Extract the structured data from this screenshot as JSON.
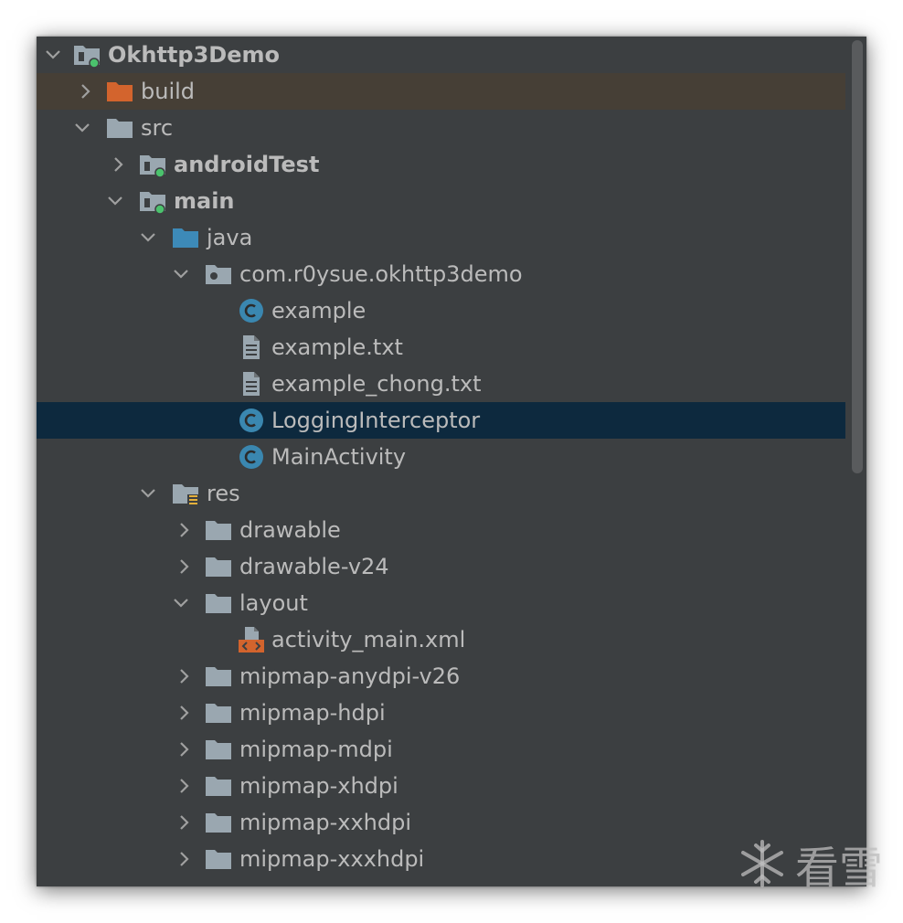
{
  "project_tree": {
    "rows": [
      {
        "label": "Okhttp3Demo",
        "icon": "module-folder-icon"
      },
      {
        "label": "build",
        "icon": "excluded-folder-icon"
      },
      {
        "label": "src",
        "icon": "folder-icon"
      },
      {
        "label": "androidTest",
        "icon": "module-folder-icon"
      },
      {
        "label": "main",
        "icon": "module-folder-icon"
      },
      {
        "label": "java",
        "icon": "source-folder-icon"
      },
      {
        "label": "com.r0ysue.okhttp3demo",
        "icon": "package-icon"
      },
      {
        "label": "example",
        "icon": "class-icon"
      },
      {
        "label": "example.txt",
        "icon": "text-file-icon"
      },
      {
        "label": "example_chong.txt",
        "icon": "text-file-icon"
      },
      {
        "label": "LoggingInterceptor",
        "icon": "class-icon"
      },
      {
        "label": "MainActivity",
        "icon": "class-icon"
      },
      {
        "label": "res",
        "icon": "resources-folder-icon"
      },
      {
        "label": "drawable",
        "icon": "folder-icon"
      },
      {
        "label": "drawable-v24",
        "icon": "folder-icon"
      },
      {
        "label": "layout",
        "icon": "folder-icon"
      },
      {
        "label": "activity_main.xml",
        "icon": "layout-xml-icon"
      },
      {
        "label": "mipmap-anydpi-v26",
        "icon": "folder-icon"
      },
      {
        "label": "mipmap-hdpi",
        "icon": "folder-icon"
      },
      {
        "label": "mipmap-mdpi",
        "icon": "folder-icon"
      },
      {
        "label": "mipmap-xhdpi",
        "icon": "folder-icon"
      },
      {
        "label": "mipmap-xxhdpi",
        "icon": "folder-icon"
      },
      {
        "label": "mipmap-xxxhdpi",
        "icon": "folder-icon"
      }
    ]
  },
  "watermark": {
    "text": "看雪"
  },
  "colors": {
    "panel_bg": "#3c3f41",
    "text": "#bbbbbb",
    "selection": "#0d293e",
    "build_highlight": "#463f36",
    "folder_gray": "#9aa7b0",
    "source_blue": "#3d8ab8",
    "excluded_orange": "#d3642d",
    "class_teal": "#3a87b0",
    "module_dot": "#4bc26d"
  }
}
